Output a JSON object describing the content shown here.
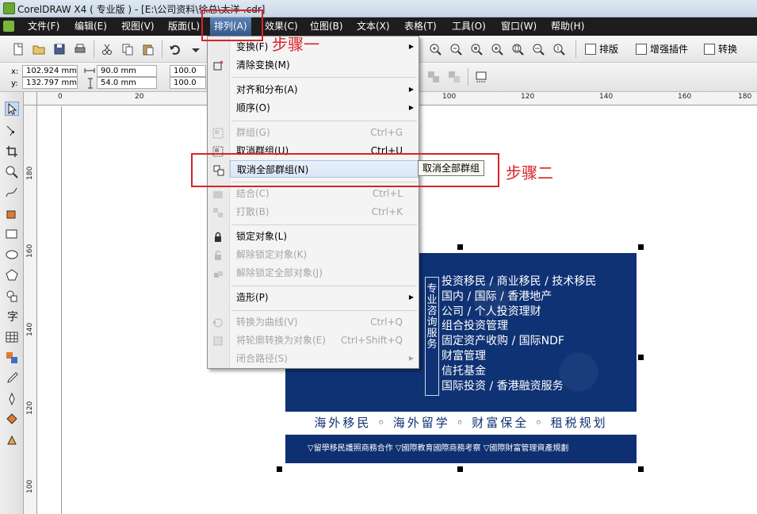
{
  "window": {
    "title": "CorelDRAW X4 ( 专业版 ) - [E:\\公司资料\\徐总\\太洋-.cdr]"
  },
  "menubar": {
    "items": [
      {
        "label": "文件(F)",
        "active": false
      },
      {
        "label": "编辑(E)",
        "active": false
      },
      {
        "label": "视图(V)",
        "active": false
      },
      {
        "label": "版面(L)",
        "active": false
      },
      {
        "label": "排列(A)",
        "active": true
      },
      {
        "label": "效果(C)",
        "active": false
      },
      {
        "label": "位图(B)",
        "active": false
      },
      {
        "label": "文本(X)",
        "active": false
      },
      {
        "label": "表格(T)",
        "active": false
      },
      {
        "label": "工具(O)",
        "active": false
      },
      {
        "label": "窗口(W)",
        "active": false
      },
      {
        "label": "帮助(H)",
        "active": false
      }
    ]
  },
  "toolbar": {
    "buttons": {
      "layout": "排版",
      "plugin": "增强插件",
      "convert": "转换"
    }
  },
  "property_bar": {
    "x": "102.924 mm",
    "y": "132.797 mm",
    "width": "90.0 mm",
    "height": "54.0 mm",
    "scale_x": "100.0",
    "scale_y": "100.0",
    "x_label": "x:",
    "y_label": "y:"
  },
  "rulers": {
    "horizontal": [
      "0",
      "20",
      "100",
      "120",
      "140",
      "160",
      "180"
    ],
    "vertical": [
      "180",
      "160",
      "140",
      "120",
      "100"
    ]
  },
  "arrange_menu": {
    "items": [
      {
        "label": "变换(F)",
        "shortcut": "",
        "submenu": true,
        "disabled": false
      },
      {
        "label": "清除变换(M)",
        "shortcut": "",
        "submenu": false,
        "disabled": false
      },
      {
        "label": "对齐和分布(A)",
        "shortcut": "",
        "submenu": true,
        "disabled": false
      },
      {
        "label": "顺序(O)",
        "shortcut": "",
        "submenu": true,
        "disabled": false
      },
      {
        "label": "群组(G)",
        "shortcut": "Ctrl+G",
        "submenu": false,
        "disabled": true
      },
      {
        "label": "取消群组(U)",
        "shortcut": "Ctrl+U",
        "submenu": false,
        "disabled": false
      },
      {
        "label": "取消全部群组(N)",
        "shortcut": "",
        "submenu": false,
        "disabled": false,
        "highlighted": true
      },
      {
        "label": "结合(C)",
        "shortcut": "Ctrl+L",
        "submenu": false,
        "disabled": true
      },
      {
        "label": "打散(B)",
        "shortcut": "Ctrl+K",
        "submenu": false,
        "disabled": true
      },
      {
        "label": "锁定对象(L)",
        "shortcut": "",
        "submenu": false,
        "disabled": false
      },
      {
        "label": "解除锁定对象(K)",
        "shortcut": "",
        "submenu": false,
        "disabled": true
      },
      {
        "label": "解除锁定全部对象(J)",
        "shortcut": "",
        "submenu": false,
        "disabled": true
      },
      {
        "label": "造形(P)",
        "shortcut": "",
        "submenu": true,
        "disabled": false
      },
      {
        "label": "转换为曲线(V)",
        "shortcut": "Ctrl+Q",
        "submenu": false,
        "disabled": true
      },
      {
        "label": "将轮廓转换为对象(E)",
        "shortcut": "Ctrl+Shift+Q",
        "submenu": false,
        "disabled": true
      },
      {
        "label": "闭合路径(S)",
        "shortcut": "",
        "submenu": true,
        "disabled": true
      }
    ],
    "tooltip": "取消全部群组"
  },
  "annotations": {
    "step1": "步骤一",
    "step2": "步骤二"
  },
  "card": {
    "vertical_label": [
      "专",
      "业",
      "咨",
      "询",
      "服",
      "务"
    ],
    "lines": [
      "投资移民 / 商业移民 / 技术移民",
      "国内 / 国际 / 香港地产",
      "公司 / 个人投资理财",
      "组合投资管理",
      "固定资产收购 / 国际NDF",
      "财富管理",
      "信托基金",
      "国际投资 / 香港融资服务"
    ],
    "slogan": "海外移民 ◦ 海外留学 ◦ 财富保全 ◦ 租税规划",
    "footer": "▽留學移民護照商務合作   ▽國際教育國際商務考察   ▽國際財富管理資產規劃"
  },
  "colors": {
    "accent_red": "#d9232a",
    "card_navy": "#0e2f71",
    "menubar_bg": "#1d1d1d"
  }
}
